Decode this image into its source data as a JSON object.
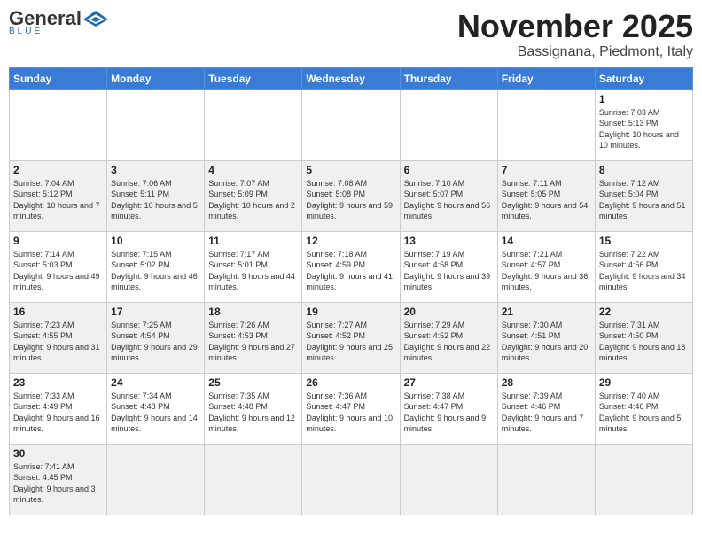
{
  "header": {
    "logo": {
      "name_black": "General",
      "name_blue": "Blue",
      "sub": "BLUE"
    },
    "title": "November 2025",
    "subtitle": "Bassignana, Piedmont, Italy"
  },
  "weekdays": [
    "Sunday",
    "Monday",
    "Tuesday",
    "Wednesday",
    "Thursday",
    "Friday",
    "Saturday"
  ],
  "weeks": [
    [
      {
        "day": "",
        "info": ""
      },
      {
        "day": "",
        "info": ""
      },
      {
        "day": "",
        "info": ""
      },
      {
        "day": "",
        "info": ""
      },
      {
        "day": "",
        "info": ""
      },
      {
        "day": "",
        "info": ""
      },
      {
        "day": "1",
        "info": "Sunrise: 7:03 AM\nSunset: 5:13 PM\nDaylight: 10 hours and 10 minutes."
      }
    ],
    [
      {
        "day": "2",
        "info": "Sunrise: 7:04 AM\nSunset: 5:12 PM\nDaylight: 10 hours and 7 minutes."
      },
      {
        "day": "3",
        "info": "Sunrise: 7:06 AM\nSunset: 5:11 PM\nDaylight: 10 hours and 5 minutes."
      },
      {
        "day": "4",
        "info": "Sunrise: 7:07 AM\nSunset: 5:09 PM\nDaylight: 10 hours and 2 minutes."
      },
      {
        "day": "5",
        "info": "Sunrise: 7:08 AM\nSunset: 5:08 PM\nDaylight: 9 hours and 59 minutes."
      },
      {
        "day": "6",
        "info": "Sunrise: 7:10 AM\nSunset: 5:07 PM\nDaylight: 9 hours and 56 minutes."
      },
      {
        "day": "7",
        "info": "Sunrise: 7:11 AM\nSunset: 5:05 PM\nDaylight: 9 hours and 54 minutes."
      },
      {
        "day": "8",
        "info": "Sunrise: 7:12 AM\nSunset: 5:04 PM\nDaylight: 9 hours and 51 minutes."
      }
    ],
    [
      {
        "day": "9",
        "info": "Sunrise: 7:14 AM\nSunset: 5:03 PM\nDaylight: 9 hours and 49 minutes."
      },
      {
        "day": "10",
        "info": "Sunrise: 7:15 AM\nSunset: 5:02 PM\nDaylight: 9 hours and 46 minutes."
      },
      {
        "day": "11",
        "info": "Sunrise: 7:17 AM\nSunset: 5:01 PM\nDaylight: 9 hours and 44 minutes."
      },
      {
        "day": "12",
        "info": "Sunrise: 7:18 AM\nSunset: 4:59 PM\nDaylight: 9 hours and 41 minutes."
      },
      {
        "day": "13",
        "info": "Sunrise: 7:19 AM\nSunset: 4:58 PM\nDaylight: 9 hours and 39 minutes."
      },
      {
        "day": "14",
        "info": "Sunrise: 7:21 AM\nSunset: 4:57 PM\nDaylight: 9 hours and 36 minutes."
      },
      {
        "day": "15",
        "info": "Sunrise: 7:22 AM\nSunset: 4:56 PM\nDaylight: 9 hours and 34 minutes."
      }
    ],
    [
      {
        "day": "16",
        "info": "Sunrise: 7:23 AM\nSunset: 4:55 PM\nDaylight: 9 hours and 31 minutes."
      },
      {
        "day": "17",
        "info": "Sunrise: 7:25 AM\nSunset: 4:54 PM\nDaylight: 9 hours and 29 minutes."
      },
      {
        "day": "18",
        "info": "Sunrise: 7:26 AM\nSunset: 4:53 PM\nDaylight: 9 hours and 27 minutes."
      },
      {
        "day": "19",
        "info": "Sunrise: 7:27 AM\nSunset: 4:52 PM\nDaylight: 9 hours and 25 minutes."
      },
      {
        "day": "20",
        "info": "Sunrise: 7:29 AM\nSunset: 4:52 PM\nDaylight: 9 hours and 22 minutes."
      },
      {
        "day": "21",
        "info": "Sunrise: 7:30 AM\nSunset: 4:51 PM\nDaylight: 9 hours and 20 minutes."
      },
      {
        "day": "22",
        "info": "Sunrise: 7:31 AM\nSunset: 4:50 PM\nDaylight: 9 hours and 18 minutes."
      }
    ],
    [
      {
        "day": "23",
        "info": "Sunrise: 7:33 AM\nSunset: 4:49 PM\nDaylight: 9 hours and 16 minutes."
      },
      {
        "day": "24",
        "info": "Sunrise: 7:34 AM\nSunset: 4:48 PM\nDaylight: 9 hours and 14 minutes."
      },
      {
        "day": "25",
        "info": "Sunrise: 7:35 AM\nSunset: 4:48 PM\nDaylight: 9 hours and 12 minutes."
      },
      {
        "day": "26",
        "info": "Sunrise: 7:36 AM\nSunset: 4:47 PM\nDaylight: 9 hours and 10 minutes."
      },
      {
        "day": "27",
        "info": "Sunrise: 7:38 AM\nSunset: 4:47 PM\nDaylight: 9 hours and 9 minutes."
      },
      {
        "day": "28",
        "info": "Sunrise: 7:39 AM\nSunset: 4:46 PM\nDaylight: 9 hours and 7 minutes."
      },
      {
        "day": "29",
        "info": "Sunrise: 7:40 AM\nSunset: 4:46 PM\nDaylight: 9 hours and 5 minutes."
      }
    ],
    [
      {
        "day": "30",
        "info": "Sunrise: 7:41 AM\nSunset: 4:45 PM\nDaylight: 9 hours and 3 minutes."
      },
      {
        "day": "",
        "info": ""
      },
      {
        "day": "",
        "info": ""
      },
      {
        "day": "",
        "info": ""
      },
      {
        "day": "",
        "info": ""
      },
      {
        "day": "",
        "info": ""
      },
      {
        "day": "",
        "info": ""
      }
    ]
  ]
}
